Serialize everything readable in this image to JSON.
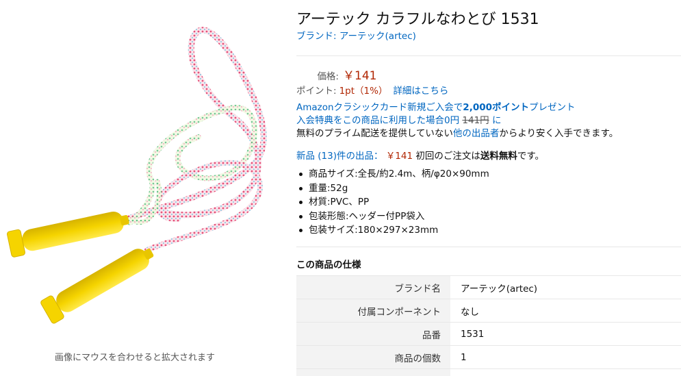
{
  "product": {
    "title": "アーテック カラフルなわとび 1531",
    "brand_prefix": "ブランド: ",
    "brand_name": "アーテック(artec)"
  },
  "image": {
    "hover_hint": "画像にマウスを合わせると拡大されます"
  },
  "price": {
    "label": "価格:",
    "value": "￥141"
  },
  "points": {
    "label": "ポイント:",
    "value": "1pt（1%）",
    "details_link": "詳細はこちら"
  },
  "promo": {
    "line1_pre": "Amazonクラシックカード新規ご入会で",
    "line1_bold": "2,000ポイント",
    "line1_post": "プレゼント",
    "line2_pre": "入会特典をこの商品に利用した場合0円",
    "line2_strike": "141円",
    "line2_post": "に",
    "line3_pre": "無料のプライム配送を提供していない",
    "line3_link": "他の出品者",
    "line3_post": "からより安く入手できます。"
  },
  "offers": {
    "new_link": "新品 (13)件の出品：",
    "price": "￥141",
    "text1": "初回のご注文は",
    "bold": "送料無料",
    "text2": "です。"
  },
  "bullets": [
    "商品サイズ:全長/約2.4m、柄/φ20×90mm",
    "重量:52g",
    "材質:PVC、PP",
    "包装形態:ヘッダー付PP袋入",
    "包装サイズ:180×297×23mm"
  ],
  "specs": {
    "heading": "この商品の仕様",
    "rows": [
      {
        "key": "ブランド名",
        "value": "アーテック(artec)"
      },
      {
        "key": "付属コンポーネント",
        "value": "なし"
      },
      {
        "key": "品番",
        "value": "1531"
      },
      {
        "key": "商品の個数",
        "value": "1"
      },
      {
        "key": "",
        "value": ""
      }
    ]
  },
  "colors": {
    "link": "#0066c0",
    "price": "#b12704",
    "handle": "#f3d400"
  }
}
